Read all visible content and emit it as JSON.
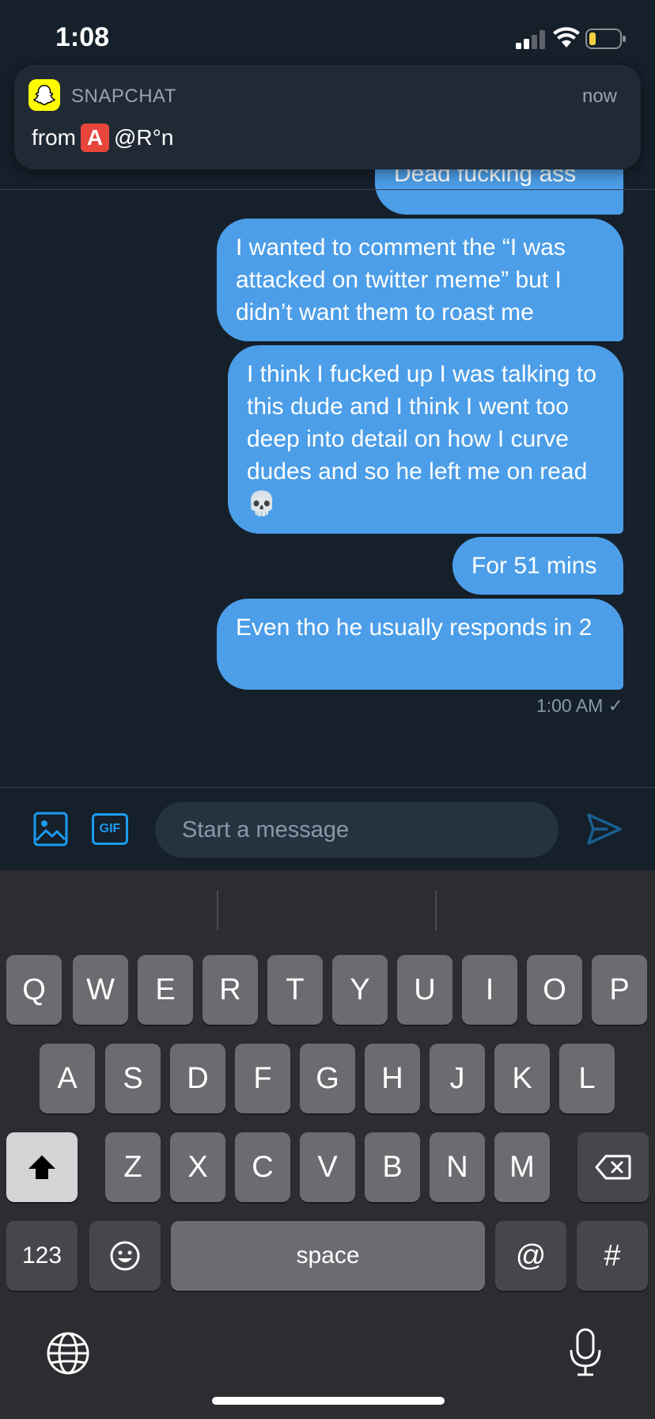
{
  "status_bar": {
    "time": "1:08"
  },
  "notification": {
    "app_name": "SNAPCHAT",
    "time": "now",
    "from_label": "from",
    "badge": "A",
    "sender": "@R°n"
  },
  "messages": [
    {
      "text": "Dead fucking ass"
    },
    {
      "text": "I wanted to comment the “I was attacked on twitter meme” but I didn’t want them to roast me"
    },
    {
      "text": "I think I fucked up I was talking to this dude and I think I went too deep into detail on how I curve dudes and so he left me on read 💀"
    },
    {
      "text": "For 51 mins"
    },
    {
      "text": "Even tho he usually responds in 2"
    }
  ],
  "message_time": "1:00 AM ✓",
  "compose": {
    "placeholder": "Start a message",
    "gif_label": "GIF"
  },
  "keyboard": {
    "row1": [
      "Q",
      "W",
      "E",
      "R",
      "T",
      "Y",
      "U",
      "I",
      "O",
      "P"
    ],
    "row2": [
      "A",
      "S",
      "D",
      "F",
      "G",
      "H",
      "J",
      "K",
      "L"
    ],
    "row3": [
      "Z",
      "X",
      "C",
      "V",
      "B",
      "N",
      "M"
    ],
    "numbers_label": "123",
    "space_label": "space",
    "at_label": "@",
    "hash_label": "#"
  }
}
